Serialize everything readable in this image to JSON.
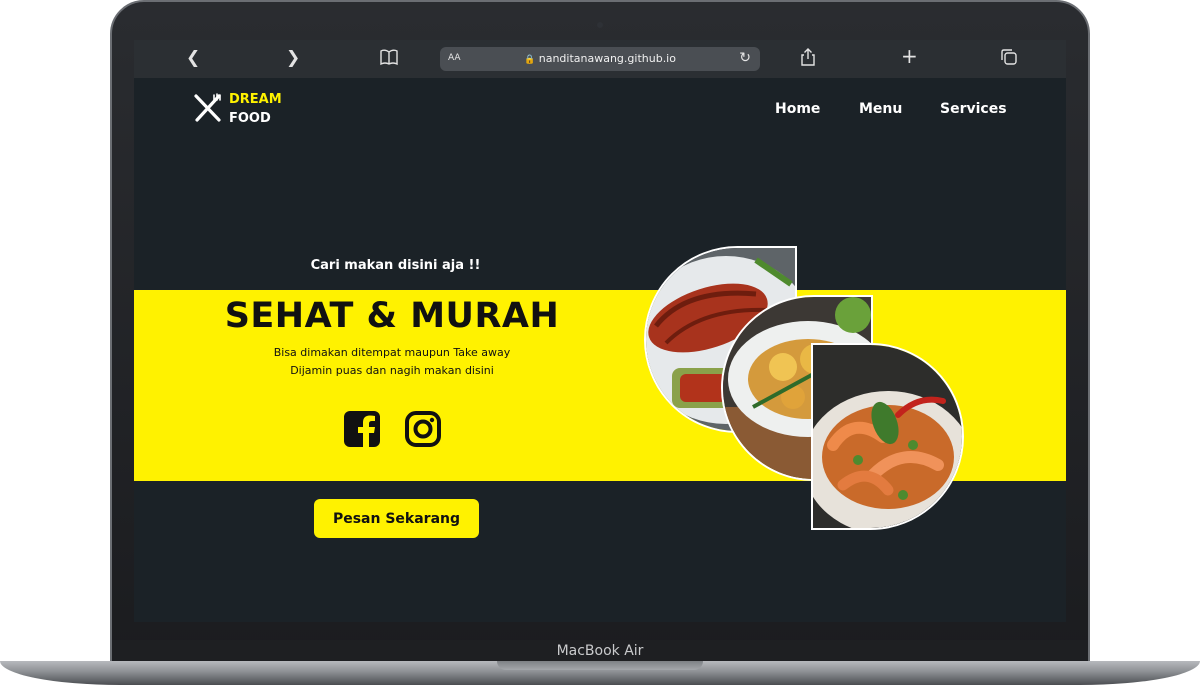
{
  "device": {
    "model_label": "MacBook Air"
  },
  "browser": {
    "back_icon": "chevron-left-icon",
    "forward_icon": "chevron-right-icon",
    "aa_label": "AA",
    "url": "nanditanawang.github.io"
  },
  "site": {
    "logo": {
      "line1": "DREAM",
      "line2": "FOOD",
      "icon": "fork-knife-icon"
    },
    "nav": [
      "Home",
      "Menu",
      "Services"
    ],
    "hero": {
      "tagline": "Cari makan disini aja !!",
      "headline": "SEHAT & MURAH",
      "desc_line1": "Bisa dimakan ditempat maupun Take away",
      "desc_line2": "Dijamin puas dan nagih makan disini",
      "cta_label": "Pesan Sekarang"
    },
    "social_icons": [
      "facebook-icon",
      "instagram-icon"
    ],
    "photos": [
      "grilled-fish",
      "fried-tofu-dish",
      "spicy-shrimp-dish"
    ]
  },
  "colors": {
    "accent": "#fff200",
    "background": "#1b2227",
    "text_dark": "#111111"
  }
}
